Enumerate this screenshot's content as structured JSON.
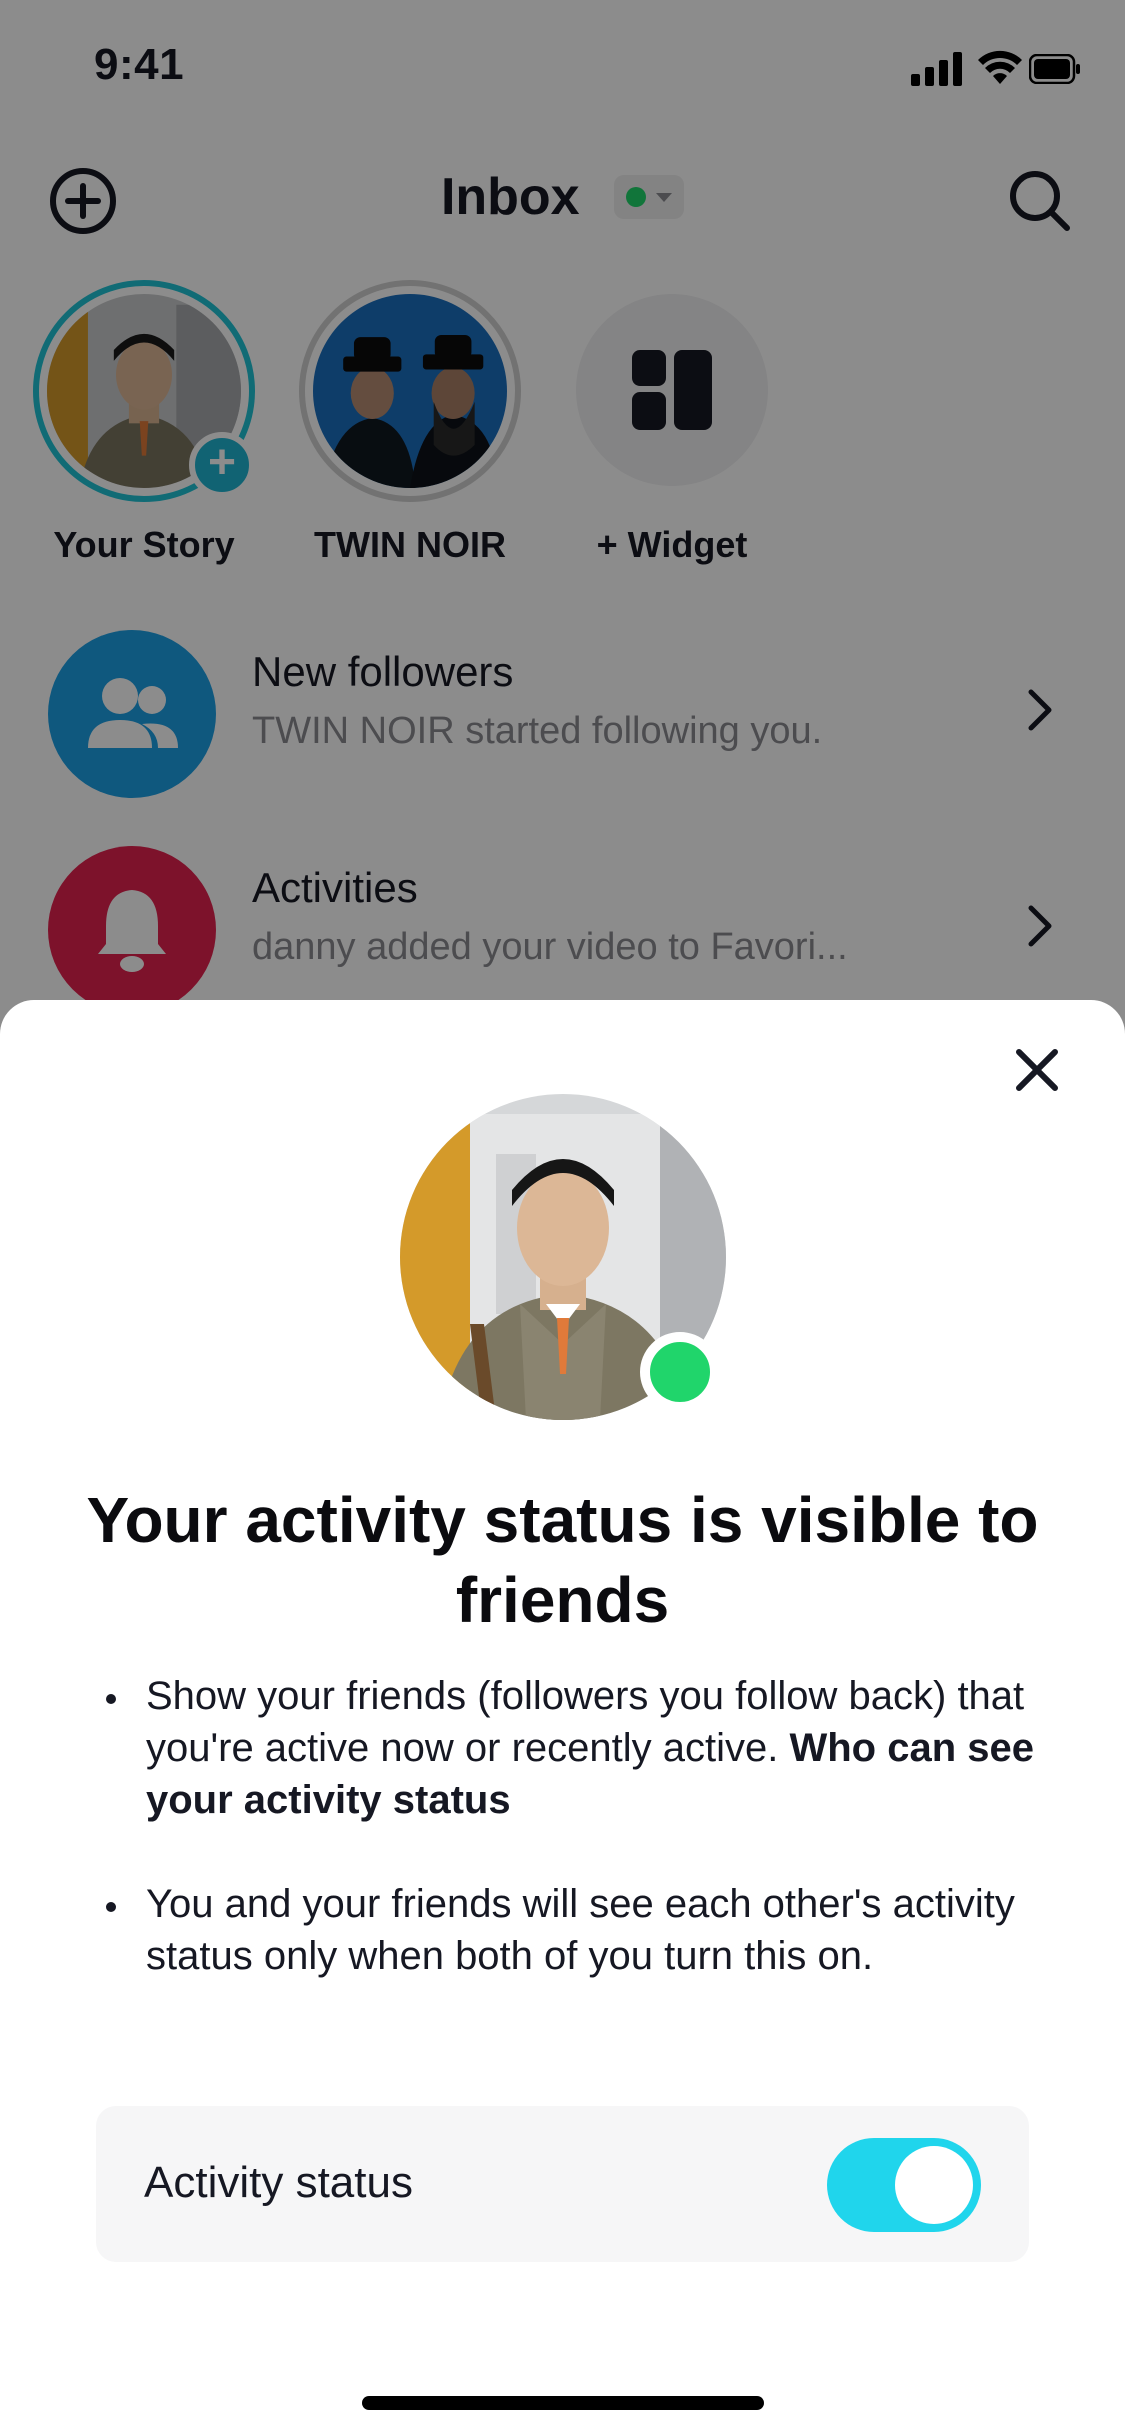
{
  "status_bar": {
    "time": "9:41"
  },
  "header": {
    "title": "Inbox",
    "status_color": "#20d56b"
  },
  "stories": [
    {
      "label": "Your Story"
    },
    {
      "label": "TWIN NOIR"
    },
    {
      "label": "+ Widget"
    }
  ],
  "notifications": [
    {
      "title": "New followers",
      "subtitle": "TWIN NOIR started following you.",
      "icon": "people-icon",
      "color": "#1da0e6"
    },
    {
      "title": "Activities",
      "subtitle": "danny added your video to Favori...",
      "icon": "bell-icon",
      "color": "#e3224f"
    }
  ],
  "sheet": {
    "heading": "Your activity status is visible to friends",
    "bullet1_text": "Show your friends (followers you follow back) that you're active now or recently active. ",
    "bullet1_bold": "Who can see your activity status",
    "bullet2_text": "You and your friends will see each other's activity status only when both of you turn this on.",
    "toggle_label": "Activity status",
    "toggle_on": true,
    "toggle_color": "#20d5ec"
  }
}
